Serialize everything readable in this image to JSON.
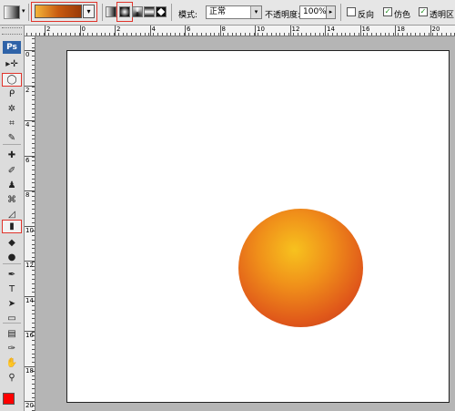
{
  "options_bar": {
    "tool_preset_icon": "gradient-tool-preset-icon",
    "gradient_colors": [
      "#f3b43a",
      "#c85a10",
      "#9a3a06"
    ],
    "gradient_types": [
      "linear",
      "radial",
      "angle",
      "reflected",
      "diamond"
    ],
    "selected_gradient_type": "radial",
    "mode_label": "模式:",
    "mode_value": "正常",
    "opacity_label": "不透明度:",
    "opacity_value": "100%",
    "reverse_label": "反向",
    "reverse_checked": false,
    "dither_label": "仿色",
    "dither_checked": true,
    "transparency_label": "透明区",
    "transparency_checked": true,
    "check_mark": "✓",
    "highlight_color": "#e0342b"
  },
  "toolbox": {
    "logo": "Ps",
    "tools": [
      {
        "name": "move-tool",
        "glyph": "▸✛",
        "selected": false
      },
      {
        "name": "elliptical-marquee-tool",
        "glyph": "◯",
        "selected": true
      },
      {
        "name": "lasso-tool",
        "glyph": "ᑭ",
        "selected": false
      },
      {
        "name": "magic-wand-tool",
        "glyph": "✲",
        "selected": false
      },
      {
        "name": "crop-tool",
        "glyph": "⌗",
        "selected": false
      },
      {
        "name": "slice-tool",
        "glyph": "✎",
        "selected": false
      },
      {
        "name": "healing-brush-tool",
        "glyph": "✚",
        "selected": false
      },
      {
        "name": "brush-tool",
        "glyph": "✐",
        "selected": false
      },
      {
        "name": "clone-stamp-tool",
        "glyph": "♟",
        "selected": false
      },
      {
        "name": "history-brush-tool",
        "glyph": "⌘",
        "selected": false
      },
      {
        "name": "eraser-tool",
        "glyph": "◿",
        "selected": false
      },
      {
        "name": "gradient-tool",
        "glyph": "▮",
        "selected": true
      },
      {
        "name": "blur-tool",
        "glyph": "◆",
        "selected": false
      },
      {
        "name": "dodge-tool",
        "glyph": "●",
        "selected": false
      },
      {
        "name": "pen-tool",
        "glyph": "✒",
        "selected": false
      },
      {
        "name": "type-tool",
        "glyph": "T",
        "selected": false
      },
      {
        "name": "path-selection-tool",
        "glyph": "➤",
        "selected": false
      },
      {
        "name": "rectangle-tool",
        "glyph": "▭",
        "selected": false
      },
      {
        "name": "notes-tool",
        "glyph": "▤",
        "selected": false
      },
      {
        "name": "eyedropper-tool",
        "glyph": "✑",
        "selected": false
      },
      {
        "name": "hand-tool",
        "glyph": "✋",
        "selected": false
      },
      {
        "name": "zoom-tool",
        "glyph": "⚲",
        "selected": false
      }
    ],
    "foreground_color": "#ff0000"
  },
  "rulers": {
    "top_labels": [
      "2",
      "0",
      "2",
      "4",
      "6",
      "8",
      "10",
      "12",
      "14",
      "16",
      "18",
      "20"
    ],
    "left_labels": [
      "0",
      "2",
      "4",
      "6",
      "8",
      "10",
      "12",
      "14",
      "16",
      "18",
      "20"
    ]
  },
  "canvas": {
    "background": "#ffffff",
    "sphere_colors": [
      "#f7c21e",
      "#f0901a",
      "#e0581a",
      "#b8381a"
    ]
  }
}
